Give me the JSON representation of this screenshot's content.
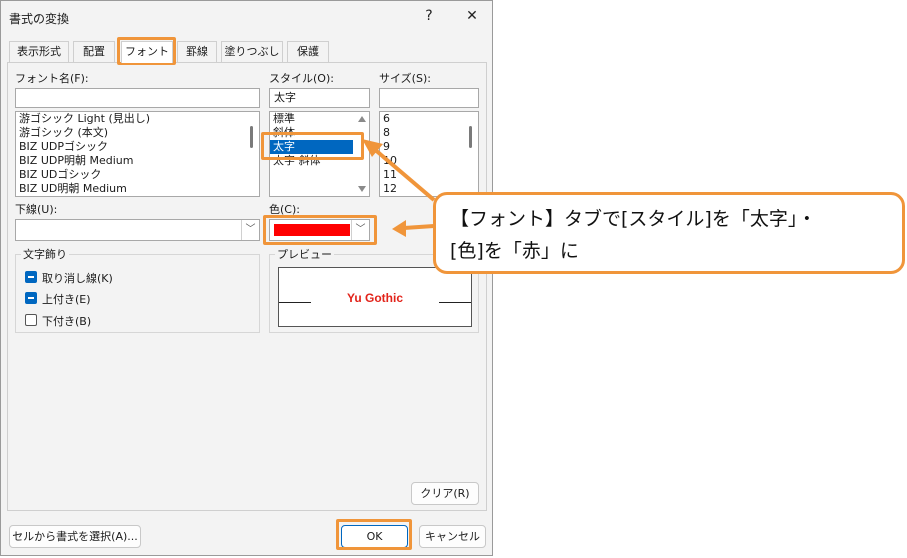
{
  "dialog": {
    "title": "書式の変換",
    "help_label": "?",
    "close_label": "✕"
  },
  "tabs": [
    {
      "label": "表示形式"
    },
    {
      "label": "配置"
    },
    {
      "label": "フォント"
    },
    {
      "label": "罫線"
    },
    {
      "label": "塗りつぶし"
    },
    {
      "label": "保護"
    }
  ],
  "font": {
    "label": "フォント名(F):",
    "value": "",
    "items": [
      "游ゴシック Light (見出し)",
      "游ゴシック (本文)",
      "BIZ UDPゴシック",
      "BIZ UDP明朝 Medium",
      "BIZ UDゴシック",
      "BIZ UD明朝 Medium"
    ]
  },
  "style": {
    "label": "スタイル(O):",
    "value": "太字",
    "items": [
      "標準",
      "斜体",
      "太字",
      "太字 斜体"
    ],
    "selected_index": 2
  },
  "size": {
    "label": "サイズ(S):",
    "value": "",
    "items": [
      "6",
      "8",
      "9",
      "10",
      "11",
      "12"
    ]
  },
  "underline": {
    "label": "下線(U):",
    "value": ""
  },
  "color": {
    "label": "色(C):",
    "swatch": "#ff0000"
  },
  "effects": {
    "title": "文字飾り",
    "strikethrough": "取り消し線(K)",
    "superscript": "上付き(E)",
    "subscript": "下付き(B)"
  },
  "preview": {
    "title": "プレビュー",
    "text": "Yu Gothic"
  },
  "buttons": {
    "clear": "クリア(R)",
    "choose_from_cell": "セルから書式を選択(A)...",
    "ok": "OK",
    "cancel": "キャンセル"
  },
  "callout": {
    "line1": "【フォント】タブで[スタイル]を「太字」・",
    "line2": "[色]を「赤」に"
  },
  "colors": {
    "accent": "#f0953a",
    "selection": "#0067c0",
    "preview_text": "#e2231a"
  }
}
